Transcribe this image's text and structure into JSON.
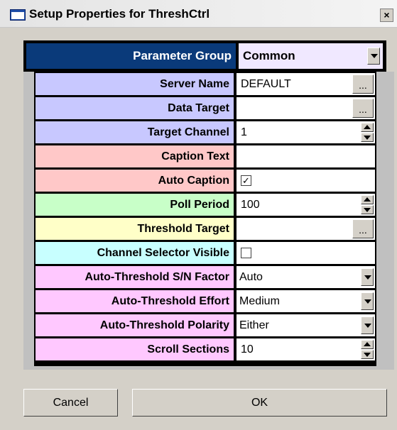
{
  "window": {
    "title": "Setup Properties for ThreshCtrl",
    "close_glyph": "×"
  },
  "parameter_group": {
    "label": "Parameter Group",
    "value": "Common"
  },
  "rows": [
    {
      "label": "Server Name",
      "value": "DEFAULT",
      "control": "ellipsis",
      "button_text": "...",
      "color": "#c8c8ff"
    },
    {
      "label": "Data Target",
      "value": "",
      "control": "ellipsis",
      "button_text": "...",
      "color": "#c8c8ff"
    },
    {
      "label": "Target Channel",
      "value": "1",
      "control": "spin",
      "color": "#c8c8ff"
    },
    {
      "label": "Caption Text",
      "value": "",
      "control": "text",
      "color": "#ffc8c8"
    },
    {
      "label": "Auto Caption",
      "value": "",
      "control": "checkbox",
      "checked": true,
      "color": "#ffc8c8"
    },
    {
      "label": "Poll Period",
      "value": "100",
      "control": "spin",
      "color": "#c8ffc8"
    },
    {
      "label": "Threshold Target",
      "value": "",
      "control": "ellipsis",
      "button_text": "...",
      "color": "#ffffc8"
    },
    {
      "label": "Channel Selector Visible",
      "value": "",
      "control": "checkbox",
      "checked": false,
      "color": "#c8ffff"
    },
    {
      "label": "Auto-Threshold S/N Factor",
      "value": "Auto",
      "control": "select",
      "color": "#ffc8ff"
    },
    {
      "label": "Auto-Threshold Effort",
      "value": "Medium",
      "control": "select",
      "color": "#ffc8ff"
    },
    {
      "label": "Auto-Threshold Polarity",
      "value": "Either",
      "control": "select",
      "color": "#ffc8ff"
    },
    {
      "label": "Scroll Sections",
      "value": "10",
      "control": "spin",
      "color": "#ffc8ff"
    }
  ],
  "buttons": {
    "cancel": "Cancel",
    "ok": "OK"
  },
  "check_glyph": "✓"
}
